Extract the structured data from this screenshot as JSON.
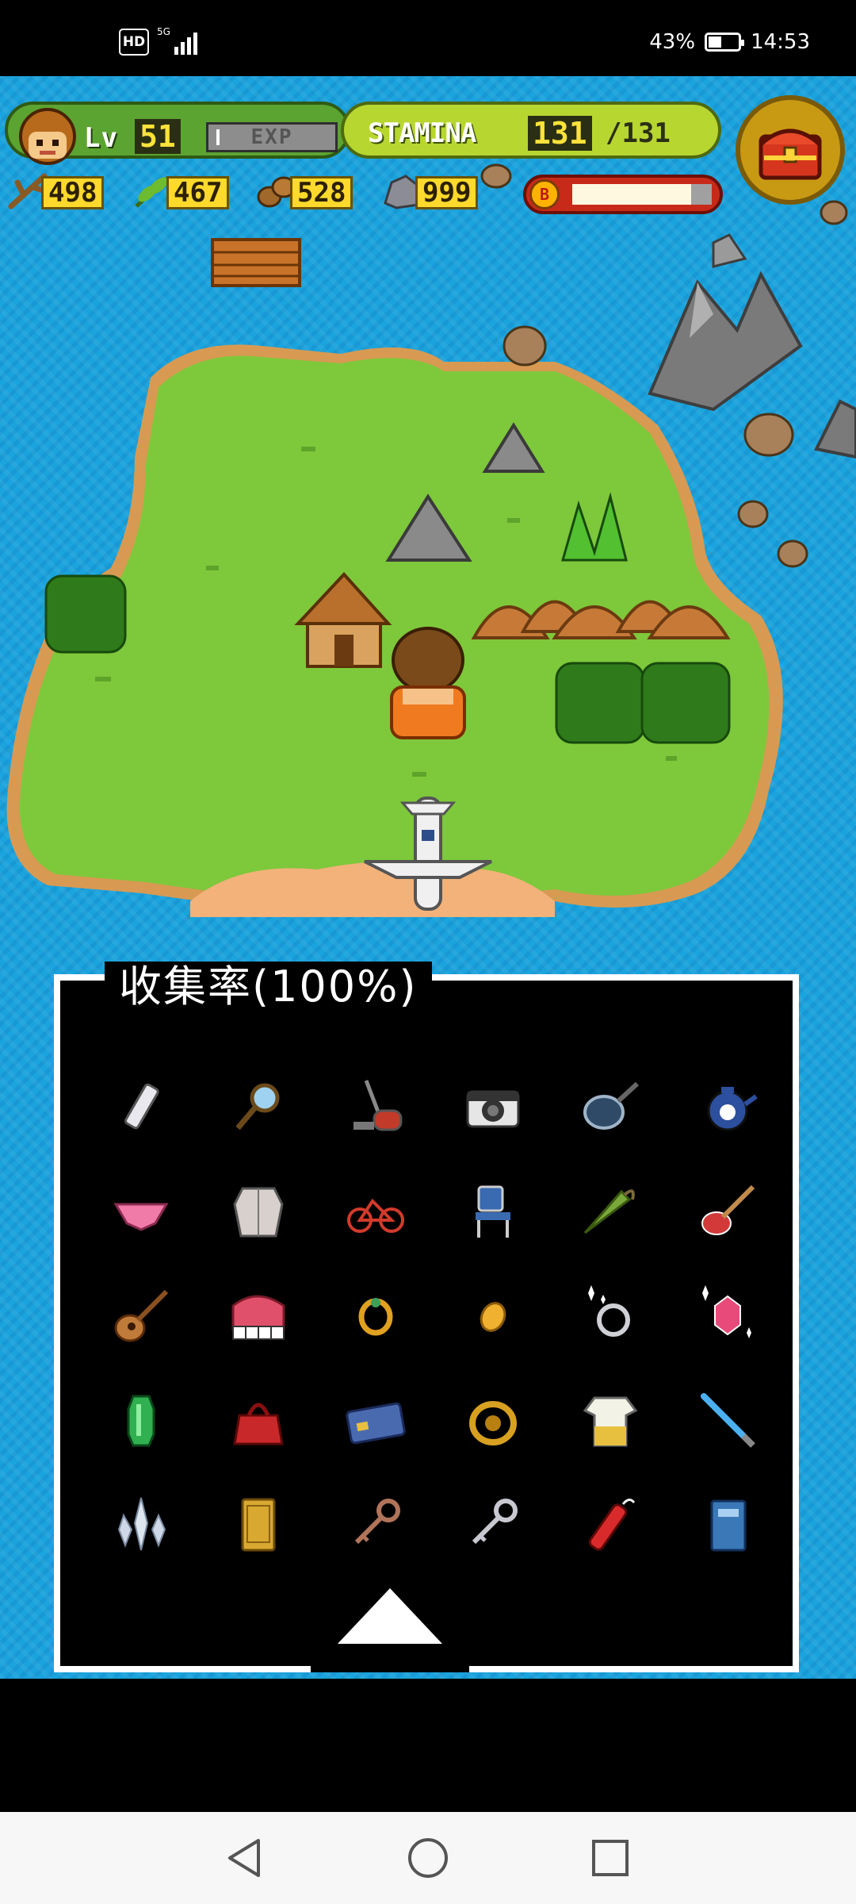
{
  "status_bar": {
    "network_badge": "HD",
    "signal_label": "5G",
    "battery_percent": "43%",
    "battery_level": 0.43,
    "time": "14:53"
  },
  "hud": {
    "level_prefix": "Lv",
    "level": "51",
    "exp_label": "EXP",
    "exp_progress": 0.02,
    "stamina_label": "STAMINA",
    "stamina_current": "131",
    "stamina_max": "/131",
    "chest_icon": "treasure-chest-icon",
    "resources": [
      {
        "icon": "branch-icon",
        "value": "498"
      },
      {
        "icon": "leaf-icon",
        "value": "467"
      },
      {
        "icon": "nuts-icon",
        "value": "528"
      },
      {
        "icon": "stone-icon",
        "value": "999"
      }
    ],
    "boost_coin_letter": "B",
    "boost_level": 0.85
  },
  "collection": {
    "title": "收集率(100%)",
    "items": [
      {
        "icon": "cellphone-icon"
      },
      {
        "icon": "magnifying-glass-icon"
      },
      {
        "icon": "vacuum-cleaner-icon"
      },
      {
        "icon": "camera-icon"
      },
      {
        "icon": "frying-pan-icon"
      },
      {
        "icon": "teapot-icon"
      },
      {
        "icon": "underwear-icon"
      },
      {
        "icon": "fur-coat-icon"
      },
      {
        "icon": "bicycle-icon"
      },
      {
        "icon": "folding-chair-icon"
      },
      {
        "icon": "umbrella-icon"
      },
      {
        "icon": "electric-guitar-icon"
      },
      {
        "icon": "acoustic-guitar-icon"
      },
      {
        "icon": "piano-icon"
      },
      {
        "icon": "gold-ring-icon"
      },
      {
        "icon": "gold-coin-icon"
      },
      {
        "icon": "diamond-ring-icon"
      },
      {
        "icon": "ruby-gem-icon"
      },
      {
        "icon": "emerald-gem-icon"
      },
      {
        "icon": "handbag-icon"
      },
      {
        "icon": "credit-card-icon"
      },
      {
        "icon": "gold-bracelet-icon"
      },
      {
        "icon": "t-shirt-icon"
      },
      {
        "icon": "lightsaber-icon"
      },
      {
        "icon": "crystal-icon"
      },
      {
        "icon": "golden-book-icon"
      },
      {
        "icon": "bronze-key-icon"
      },
      {
        "icon": "silver-key-icon"
      },
      {
        "icon": "dynamite-icon"
      },
      {
        "icon": "blue-book-icon"
      }
    ],
    "scroll_icon": "triangle-up-icon"
  },
  "nav": {
    "back_icon": "back-triangle-icon",
    "home_icon": "home-circle-icon",
    "recents_icon": "recents-square-icon"
  },
  "colors": {
    "ocean": "#1aa3dc",
    "grass": "#7ec83b",
    "panel_bg": "#000000",
    "panel_border": "#ffffff",
    "hud_yellow": "#ffd92c"
  }
}
